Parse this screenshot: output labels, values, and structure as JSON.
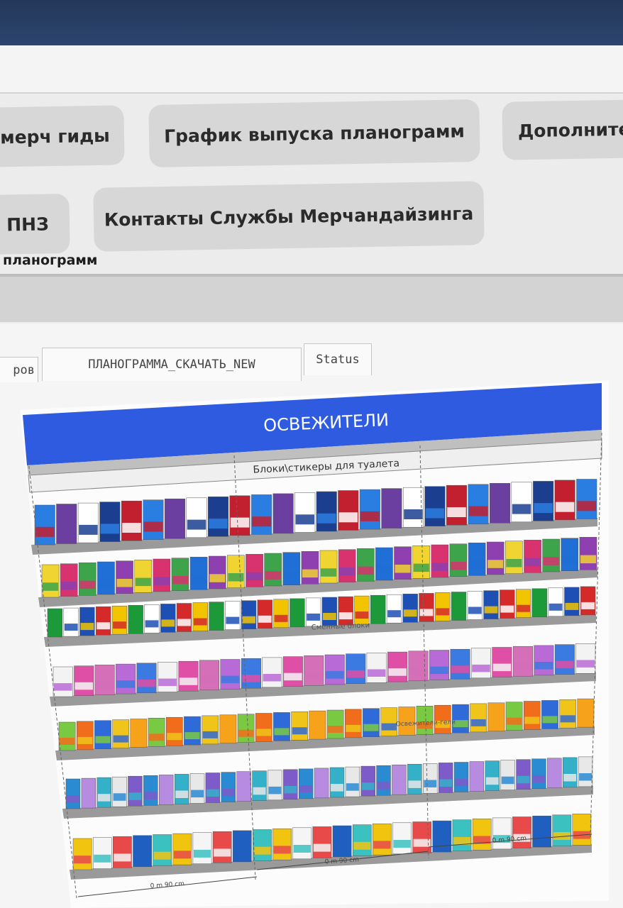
{
  "nav": {
    "row1": [
      {
        "label": "мерч гиды"
      },
      {
        "label": "График выпуска планограмм"
      },
      {
        "label": "Дополнител"
      }
    ],
    "row2": [
      {
        "label": "ПНЗ"
      },
      {
        "label": "Контакты Службы Мерчандайзинга"
      }
    ]
  },
  "section": {
    "title": "планограмм"
  },
  "tabs": [
    {
      "label": "ров"
    },
    {
      "label": "ПЛАНОГРАММА_СКАЧАТЬ_NEW"
    },
    {
      "label": "Status"
    }
  ],
  "planogram": {
    "header": "ОСВЕЖИТЕЛИ",
    "header_color": "#2f5be0",
    "section_labels": {
      "top": "Блоки\\стикеры для туалета",
      "refills": "Сменные блоки",
      "gel": "Освежители-гели"
    },
    "dimensions": [
      "0 m 90 cm",
      "0 m 90 cm",
      "0 m 90 cm"
    ]
  }
}
